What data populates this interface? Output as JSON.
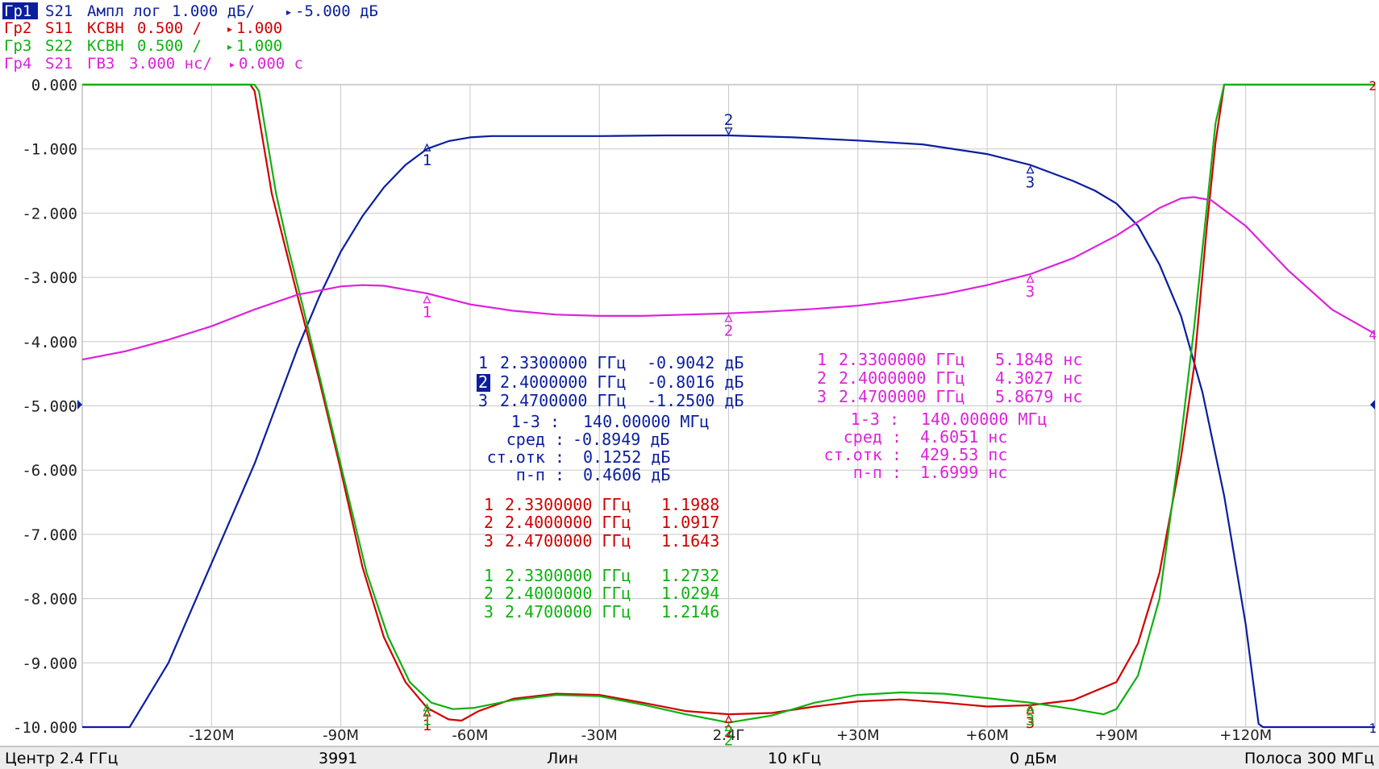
{
  "colors": {
    "trace1": "#0a1e9e",
    "trace2": "#d00000",
    "trace3": "#10b010",
    "trace4": "#dd22dd",
    "grid": "#c8c8c8",
    "axis_text": "#202020",
    "status_bg": "#ececec"
  },
  "traces": [
    {
      "id": "Гр1",
      "param": "S21",
      "format": "Ампл лог",
      "scale": "1.000 дБ/",
      "ref": "-5.000 дБ",
      "active": true
    },
    {
      "id": "Гр2",
      "param": "S11",
      "format": "КСВН",
      "scale": "0.500 /",
      "ref": "1.000",
      "active": false
    },
    {
      "id": "Гр3",
      "param": "S22",
      "format": "КСВН",
      "scale": "0.500 /",
      "ref": "1.000",
      "active": false
    },
    {
      "id": "Гр4",
      "param": "S21",
      "format": "ГВЗ",
      "scale": "3.000 нс/",
      "ref": "0.000 с",
      "active": false
    }
  ],
  "status_bar": {
    "center": "Центр 2.4 ГГц",
    "points": "3991",
    "sweep": "Лин",
    "ifbw": "10 кГц",
    "power": "0 дБм",
    "span": "Полоса 300 МГц"
  },
  "marker_tables": {
    "trace1": {
      "rows": [
        {
          "n": "1",
          "freq": "2.3300000 ГГц",
          "value": "-0.9042 дБ"
        },
        {
          "n": "2",
          "freq": "2.4000000 ГГц",
          "value": "-0.8016 дБ",
          "active": true
        },
        {
          "n": "3",
          "freq": "2.4700000 ГГц",
          "value": "-1.2500 дБ"
        }
      ],
      "stats": {
        "span_label": "1-3 :",
        "span_value": "140.00000 МГц",
        "mean_label": "сред :",
        "mean_value": "-0.8949 дБ",
        "std_label": "ст.отк :",
        "std_value": "0.1252 дБ",
        "pp_label": "п-п :",
        "pp_value": "0.4606 дБ"
      }
    },
    "trace4": {
      "rows": [
        {
          "n": "1",
          "freq": "2.3300000 ГГц",
          "value": "5.1848 нс"
        },
        {
          "n": "2",
          "freq": "2.4000000 ГГц",
          "value": "4.3027 нс"
        },
        {
          "n": "3",
          "freq": "2.4700000 ГГц",
          "value": "5.8679 нс"
        }
      ],
      "stats": {
        "span_label": "1-3 :",
        "span_value": "140.00000 МГц",
        "mean_label": "сред :",
        "mean_value": "4.6051 нс",
        "std_label": "ст.отк :",
        "std_value": "429.53 пс",
        "pp_label": "п-п :",
        "pp_value": "1.6999 нс"
      }
    },
    "trace2": {
      "rows": [
        {
          "n": "1",
          "freq": "2.3300000 ГГц",
          "value": "1.1988"
        },
        {
          "n": "2",
          "freq": "2.4000000 ГГц",
          "value": "1.0917"
        },
        {
          "n": "3",
          "freq": "2.4700000 ГГц",
          "value": "1.1643"
        }
      ]
    },
    "trace3": {
      "rows": [
        {
          "n": "1",
          "freq": "2.3300000 ГГц",
          "value": "1.2732"
        },
        {
          "n": "2",
          "freq": "2.4000000 ГГц",
          "value": "1.0294"
        },
        {
          "n": "3",
          "freq": "2.4700000 ГГц",
          "value": "1.2146"
        }
      ]
    }
  },
  "chart_data": {
    "type": "line",
    "x_unit": "MHz offset from 2.4 GHz",
    "xlim": [
      -150,
      150
    ],
    "ylim": [
      -10,
      0
    ],
    "grid": true,
    "y_ticks": [
      "0.000",
      "-1.000",
      "-2.000",
      "-3.000",
      "-4.000",
      "-5.000",
      "-6.000",
      "-7.000",
      "-8.000",
      "-9.000",
      "-10.000"
    ],
    "x_ticks": [
      {
        "x": -120,
        "label": "-120M"
      },
      {
        "x": -90,
        "label": "-90M"
      },
      {
        "x": -60,
        "label": "-60M"
      },
      {
        "x": -30,
        "label": "-30M"
      },
      {
        "x": 0,
        "label": "2.4Г"
      },
      {
        "x": 30,
        "label": "+30M"
      },
      {
        "x": 60,
        "label": "+60M"
      },
      {
        "x": 90,
        "label": "+90M"
      },
      {
        "x": 120,
        "label": "+120M"
      }
    ],
    "series": [
      {
        "key": "trace1",
        "points": [
          [
            -150,
            -10
          ],
          [
            -139,
            -10
          ],
          [
            -130,
            -9.0
          ],
          [
            -120,
            -7.45
          ],
          [
            -110,
            -5.9
          ],
          [
            -100,
            -4.1
          ],
          [
            -95,
            -3.3
          ],
          [
            -90,
            -2.6
          ],
          [
            -85,
            -2.05
          ],
          [
            -80,
            -1.6
          ],
          [
            -75,
            -1.25
          ],
          [
            -70,
            -1.0
          ],
          [
            -65,
            -0.88
          ],
          [
            -60,
            -0.82
          ],
          [
            -55,
            -0.8
          ],
          [
            -45,
            -0.8
          ],
          [
            -30,
            -0.8
          ],
          [
            -15,
            -0.79
          ],
          [
            0,
            -0.79
          ],
          [
            15,
            -0.82
          ],
          [
            30,
            -0.87
          ],
          [
            45,
            -0.93
          ],
          [
            60,
            -1.08
          ],
          [
            70,
            -1.25
          ],
          [
            80,
            -1.5
          ],
          [
            85,
            -1.65
          ],
          [
            90,
            -1.85
          ],
          [
            95,
            -2.2
          ],
          [
            100,
            -2.8
          ],
          [
            105,
            -3.6
          ],
          [
            110,
            -4.8
          ],
          [
            115,
            -6.4
          ],
          [
            120,
            -8.4
          ],
          [
            123,
            -9.95
          ],
          [
            124,
            -10
          ],
          [
            150,
            -10
          ]
        ]
      },
      {
        "key": "trace2",
        "points": [
          [
            -150,
            0
          ],
          [
            -111,
            0
          ],
          [
            -110,
            -0.1
          ],
          [
            -106,
            -1.7
          ],
          [
            -103,
            -2.5
          ],
          [
            -100,
            -3.3
          ],
          [
            -95,
            -4.6
          ],
          [
            -90,
            -6.0
          ],
          [
            -85,
            -7.5
          ],
          [
            -80,
            -8.6
          ],
          [
            -75,
            -9.3
          ],
          [
            -70,
            -9.7
          ],
          [
            -65,
            -9.88
          ],
          [
            -62,
            -9.9
          ],
          [
            -58,
            -9.75
          ],
          [
            -50,
            -9.56
          ],
          [
            -40,
            -9.48
          ],
          [
            -30,
            -9.5
          ],
          [
            -20,
            -9.62
          ],
          [
            -10,
            -9.75
          ],
          [
            0,
            -9.8
          ],
          [
            10,
            -9.78
          ],
          [
            20,
            -9.68
          ],
          [
            30,
            -9.6
          ],
          [
            40,
            -9.57
          ],
          [
            50,
            -9.62
          ],
          [
            60,
            -9.68
          ],
          [
            70,
            -9.66
          ],
          [
            80,
            -9.58
          ],
          [
            90,
            -9.3
          ],
          [
            95,
            -8.7
          ],
          [
            100,
            -7.6
          ],
          [
            105,
            -5.8
          ],
          [
            108,
            -4.4
          ],
          [
            111,
            -2.2
          ],
          [
            113,
            -0.9
          ],
          [
            115,
            0
          ],
          [
            150,
            0
          ]
        ]
      },
      {
        "key": "trace3",
        "points": [
          [
            -150,
            0
          ],
          [
            -110,
            0
          ],
          [
            -109,
            -0.1
          ],
          [
            -105,
            -1.7
          ],
          [
            -102,
            -2.6
          ],
          [
            -99,
            -3.4
          ],
          [
            -94,
            -4.8
          ],
          [
            -89,
            -6.2
          ],
          [
            -84,
            -7.6
          ],
          [
            -79,
            -8.6
          ],
          [
            -74,
            -9.3
          ],
          [
            -69,
            -9.62
          ],
          [
            -64,
            -9.72
          ],
          [
            -59,
            -9.7
          ],
          [
            -50,
            -9.58
          ],
          [
            -40,
            -9.5
          ],
          [
            -30,
            -9.52
          ],
          [
            -20,
            -9.65
          ],
          [
            -10,
            -9.8
          ],
          [
            0,
            -9.93
          ],
          [
            10,
            -9.82
          ],
          [
            20,
            -9.62
          ],
          [
            30,
            -9.5
          ],
          [
            40,
            -9.46
          ],
          [
            50,
            -9.48
          ],
          [
            60,
            -9.55
          ],
          [
            70,
            -9.62
          ],
          [
            80,
            -9.72
          ],
          [
            87,
            -9.8
          ],
          [
            90,
            -9.72
          ],
          [
            95,
            -9.2
          ],
          [
            100,
            -8.0
          ],
          [
            105,
            -5.5
          ],
          [
            108,
            -3.8
          ],
          [
            111,
            -1.9
          ],
          [
            113,
            -0.6
          ],
          [
            115,
            0
          ],
          [
            150,
            0
          ]
        ]
      },
      {
        "key": "trace4",
        "points": [
          [
            -150,
            -4.28
          ],
          [
            -140,
            -4.15
          ],
          [
            -130,
            -3.97
          ],
          [
            -120,
            -3.76
          ],
          [
            -110,
            -3.5
          ],
          [
            -100,
            -3.27
          ],
          [
            -90,
            -3.14
          ],
          [
            -85,
            -3.12
          ],
          [
            -80,
            -3.13
          ],
          [
            -70,
            -3.25
          ],
          [
            -60,
            -3.42
          ],
          [
            -50,
            -3.52
          ],
          [
            -40,
            -3.58
          ],
          [
            -30,
            -3.6
          ],
          [
            -20,
            -3.6
          ],
          [
            -10,
            -3.58
          ],
          [
            0,
            -3.56
          ],
          [
            10,
            -3.53
          ],
          [
            20,
            -3.49
          ],
          [
            30,
            -3.44
          ],
          [
            40,
            -3.36
          ],
          [
            50,
            -3.26
          ],
          [
            60,
            -3.12
          ],
          [
            70,
            -2.95
          ],
          [
            80,
            -2.7
          ],
          [
            90,
            -2.35
          ],
          [
            100,
            -1.92
          ],
          [
            105,
            -1.77
          ],
          [
            108,
            -1.75
          ],
          [
            112,
            -1.8
          ],
          [
            120,
            -2.2
          ],
          [
            130,
            -2.9
          ],
          [
            140,
            -3.5
          ],
          [
            150,
            -3.88
          ]
        ]
      }
    ],
    "markers": [
      {
        "trace": "trace1",
        "label": "1",
        "x": -70,
        "y": -0.9042
      },
      {
        "trace": "trace1",
        "label": "2",
        "x": 0,
        "y": -0.8016
      },
      {
        "trace": "trace1",
        "label": "3",
        "x": 70,
        "y": -1.25
      },
      {
        "trace": "trace4",
        "label": "1",
        "x": -70,
        "y": -3.27
      },
      {
        "trace": "trace4",
        "label": "2",
        "x": 0,
        "y": -3.56
      },
      {
        "trace": "trace4",
        "label": "3",
        "x": 70,
        "y": -2.95
      },
      {
        "trace": "trace2",
        "label": "1",
        "x": -70,
        "y": -9.7
      },
      {
        "trace": "trace2",
        "label": "2",
        "x": 0,
        "y": -9.8
      },
      {
        "trace": "trace2",
        "label": "3",
        "x": 70,
        "y": -9.66
      },
      {
        "trace": "trace3",
        "label": "1",
        "x": -70,
        "y": -9.62
      },
      {
        "trace": "trace3",
        "label": "2",
        "x": 0,
        "y": -9.93
      },
      {
        "trace": "trace3",
        "label": "3",
        "x": 70,
        "y": -9.62
      }
    ],
    "right_edge_labels": [
      {
        "trace": "trace2",
        "label": "2",
        "y": 0
      },
      {
        "trace": "trace4",
        "label": "4",
        "y": -3.88
      },
      {
        "trace": "trace1",
        "label": "1",
        "y": -10
      }
    ]
  }
}
